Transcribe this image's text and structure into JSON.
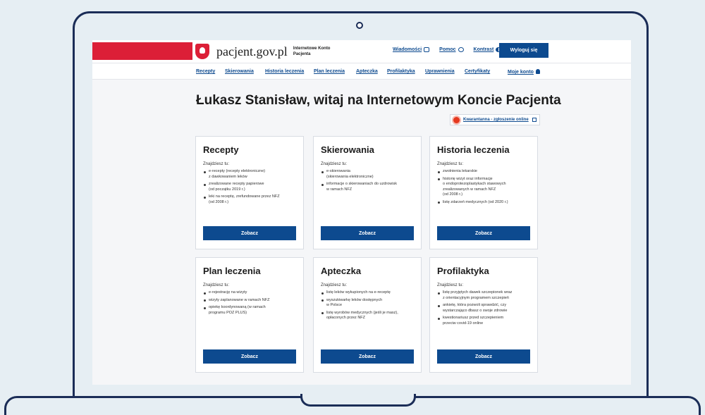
{
  "header": {
    "site_name": "pacjent.gov.pl",
    "site_subtitle": "Internetowe Konto Pacjenta",
    "links": [
      {
        "label": "Wiadomości",
        "icon": "envelope-icon"
      },
      {
        "label": "Pomoc",
        "icon": "help-icon"
      },
      {
        "label": "Kontrast",
        "icon": "contrast-icon"
      }
    ],
    "logout": "Wyloguj się"
  },
  "menu": {
    "items": [
      "Recepty",
      "Skierowania",
      "Historia leczenia",
      "Plan leczenia",
      "Apteczka",
      "Profilaktyka",
      "Uprawnienia",
      "Certyfikaty"
    ],
    "account": "Moje konto"
  },
  "headline": "Łukasz Stanisław, witaj na Internetowym Koncie Pacjenta",
  "quarantine_link": "Kwarantanna - zgłoszenie online",
  "cards": [
    {
      "title": "Recepty",
      "intro": "Znajdziesz tu:",
      "items": [
        "e-recepty (recepty elektroniczne)\nz dawkowaniem leków",
        "zrealizowane recepty papierowe\n(od początku 2019 r.)",
        "leki na receptę, zrefundowane przez NFZ\n(od 2008 r.)"
      ],
      "button": "Zobacz"
    },
    {
      "title": "Skierowania",
      "intro": "Znajdziesz tu:",
      "items": [
        "e-skierowania\n(skierowania elektroniczne)",
        "informacje o skierowaniach do uzdrowisk\nw ramach NFZ"
      ],
      "button": "Zobacz"
    },
    {
      "title": "Historia leczenia",
      "intro": "Znajdziesz tu:",
      "items": [
        "zwolnienia lekarskie",
        "historię wizyt oraz informacje\no endoprotezoplastykach stawowych\nzrealizowanych w ramach NFZ\n(od 2008 r.)",
        "listę zdarzeń medycznych (od 2020 r.)"
      ],
      "button": "Zobacz"
    },
    {
      "title": "Plan leczenia",
      "intro": "Znajdziesz tu:",
      "items": [
        "e-rejestrację na wizyty",
        "wizyty zaplanowane w ramach NFZ",
        "opiekę koordynowaną (w ramach\nprogramu POZ PLUS)"
      ],
      "button": "Zobacz"
    },
    {
      "title": "Apteczka",
      "intro": "Znajdziesz tu:",
      "items": [
        "listę leków wykupionych na e-receptę",
        "wyszukiwarkę leków dostępnych\nw Polsce",
        "listę wyrobów medycznych (jeśli je masz),\nopłaconych przez NFZ"
      ],
      "button": "Zobacz"
    },
    {
      "title": "Profilaktyka",
      "intro": "Znajdziesz tu:",
      "items": [
        "listę przyjętych dawek szczepionek wraz\nz orientacyjnym programem szczepień",
        "ankietę, która pozwoli sprawdzić, czy\nwystarczająco dbasz o swoje zdrowie",
        "kwestionariusz przed szczepieniem\nprzeciw covid-19 online"
      ],
      "button": "Zobacz"
    }
  ]
}
